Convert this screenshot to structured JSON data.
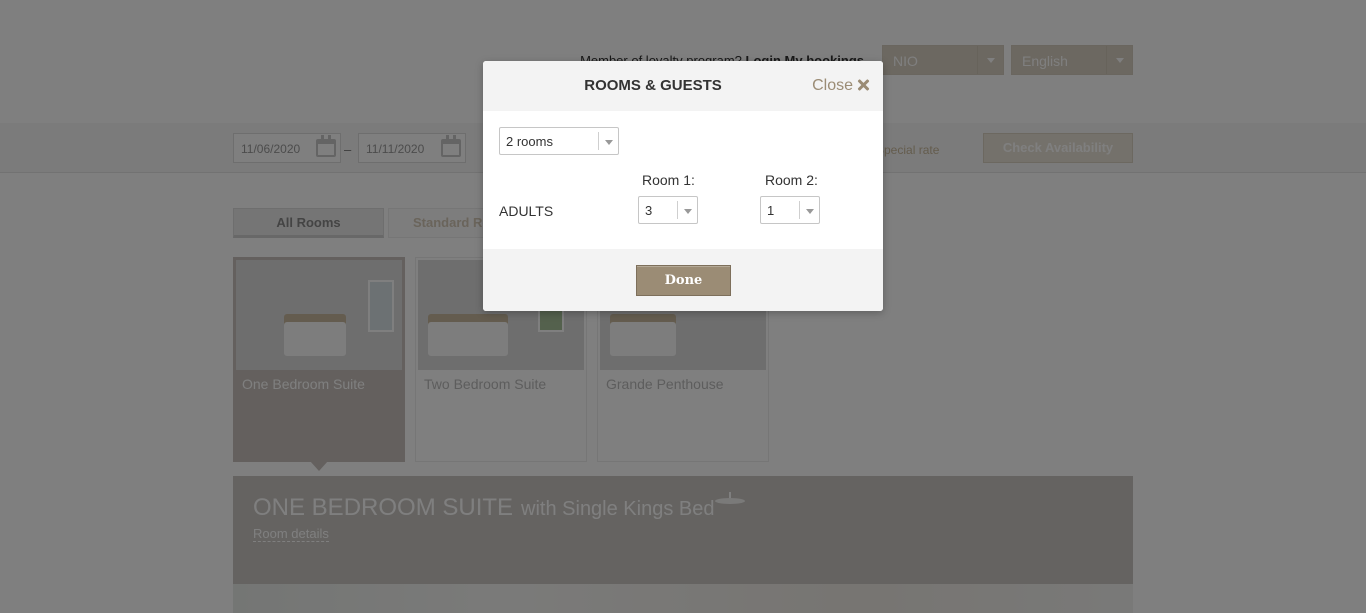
{
  "header": {
    "loyalty_text": "Member of loyalty program?",
    "login_label": "Login",
    "bookings_label": "My bookings",
    "currency": "NIO",
    "language": "English"
  },
  "search": {
    "check_in": "11/06/2020",
    "separator": "–",
    "check_out": "11/11/2020",
    "special_rate": "Special rate",
    "check_button": "Check Availability"
  },
  "tabs": [
    {
      "label": "All Rooms"
    },
    {
      "label": "Standard Rooms"
    }
  ],
  "rooms": [
    {
      "name": "One Bedroom Suite"
    },
    {
      "name": "Two Bedroom Suite"
    },
    {
      "name": "Grande Penthouse"
    }
  ],
  "selected_room": {
    "title": "ONE BEDROOM SUITE",
    "subtitle": "with Single Kings Bed",
    "details_link": "Room details"
  },
  "modal": {
    "title": "ROOMS & GUESTS",
    "close_label": "Close",
    "rooms_value": "2 rooms",
    "room1_label": "Room 1:",
    "room2_label": "Room 2:",
    "adults_label": "ADULTS",
    "room1_adults": "3",
    "room2_adults": "1",
    "done_label": "Done"
  }
}
